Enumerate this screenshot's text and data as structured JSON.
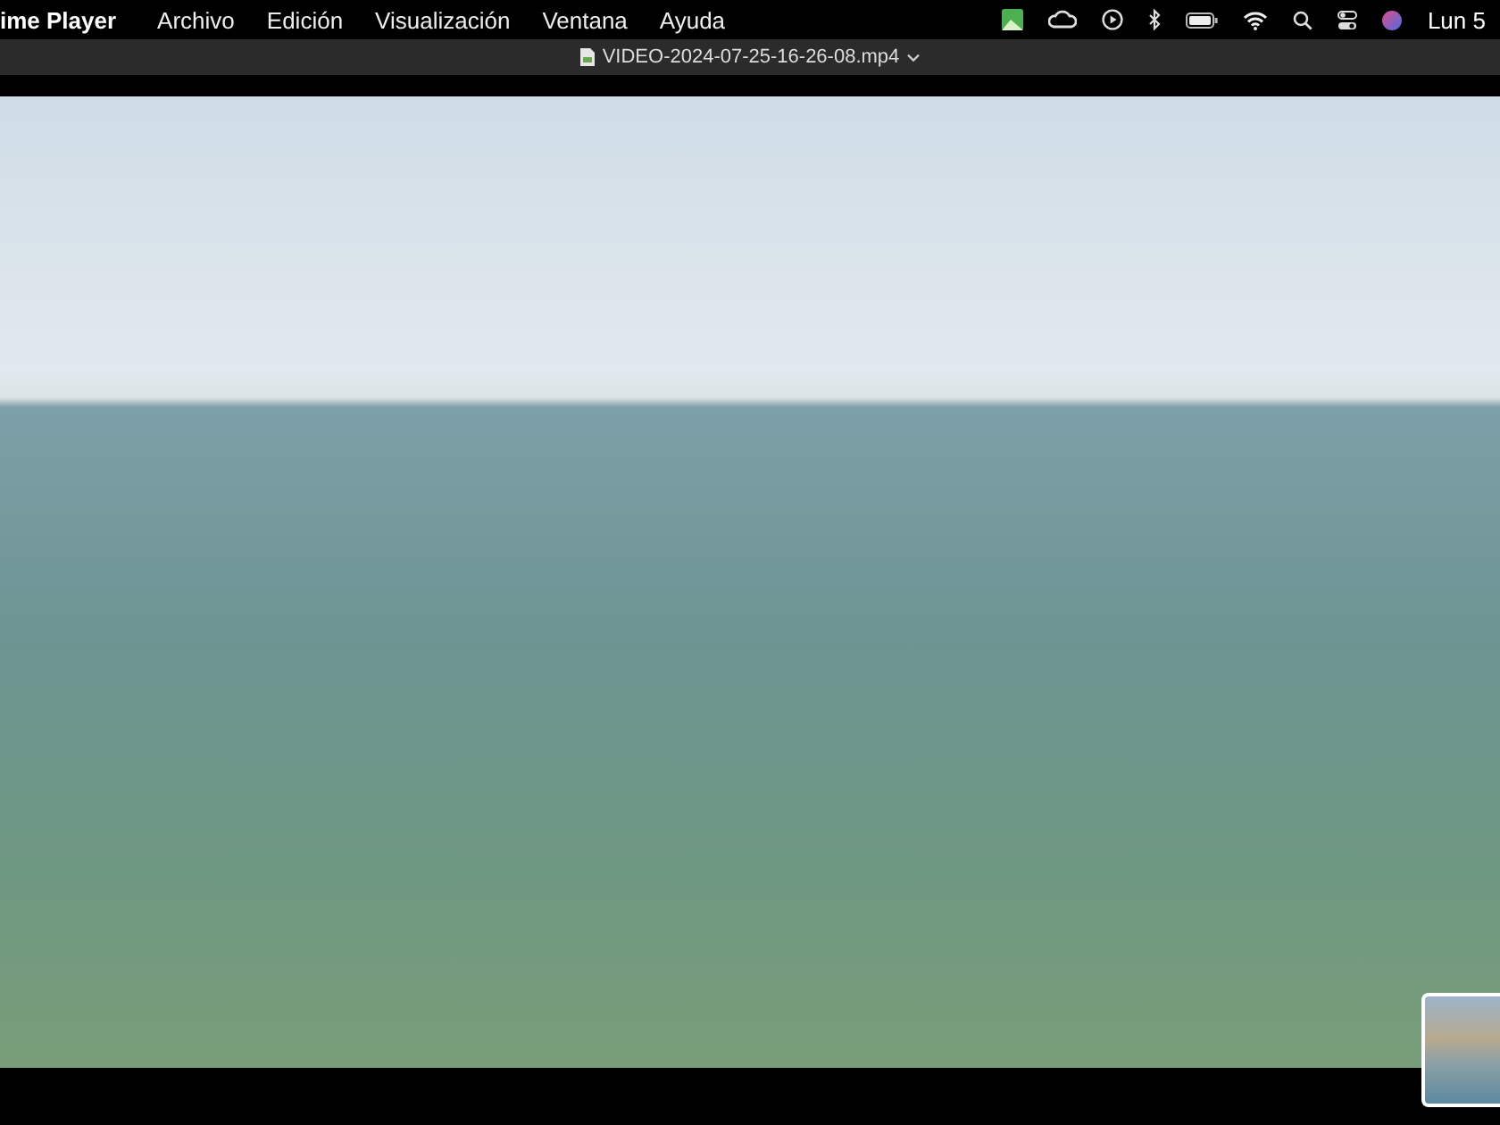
{
  "menu_bar": {
    "app_name": "ime Player",
    "menus": [
      "Archivo",
      "Edición",
      "Visualización",
      "Ventana",
      "Ayuda"
    ],
    "clock": "Lun 5"
  },
  "window": {
    "title": "VIDEO-2024-07-25-16-26-08.mp4"
  }
}
